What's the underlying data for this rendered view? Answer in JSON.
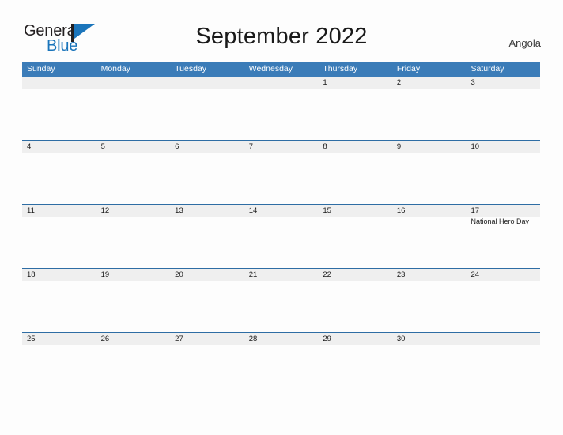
{
  "brand": {
    "name_part1": "General",
    "name_part2": "Blue",
    "flag_icon": "flag-triangle-icon",
    "color_dark": "#231f20",
    "color_blue": "#1b75bb"
  },
  "header": {
    "title": "September 2022",
    "country": "Angola"
  },
  "theme": {
    "header_blue": "#3b7cb8",
    "rule_blue": "#2e6da4",
    "date_band_gray": "#efefef",
    "page_background": "#fdfdfd",
    "text_dark": "#1a1a1a"
  },
  "calendar": {
    "month": "September",
    "year": "2022",
    "day_headers": [
      "Sunday",
      "Monday",
      "Tuesday",
      "Wednesday",
      "Thursday",
      "Friday",
      "Saturday"
    ],
    "weeks": [
      {
        "dates": [
          "",
          "",
          "",
          "",
          "1",
          "2",
          "3"
        ],
        "events": [
          [],
          [],
          [],
          [],
          [],
          [],
          []
        ]
      },
      {
        "dates": [
          "4",
          "5",
          "6",
          "7",
          "8",
          "9",
          "10"
        ],
        "events": [
          [],
          [],
          [],
          [],
          [],
          [],
          []
        ]
      },
      {
        "dates": [
          "11",
          "12",
          "13",
          "14",
          "15",
          "16",
          "17"
        ],
        "events": [
          [],
          [],
          [],
          [],
          [],
          [],
          [
            "National Hero Day"
          ]
        ]
      },
      {
        "dates": [
          "18",
          "19",
          "20",
          "21",
          "22",
          "23",
          "24"
        ],
        "events": [
          [],
          [],
          [],
          [],
          [],
          [],
          []
        ]
      },
      {
        "dates": [
          "25",
          "26",
          "27",
          "28",
          "29",
          "30",
          ""
        ],
        "events": [
          [],
          [],
          [],
          [],
          [],
          [],
          []
        ]
      }
    ]
  }
}
